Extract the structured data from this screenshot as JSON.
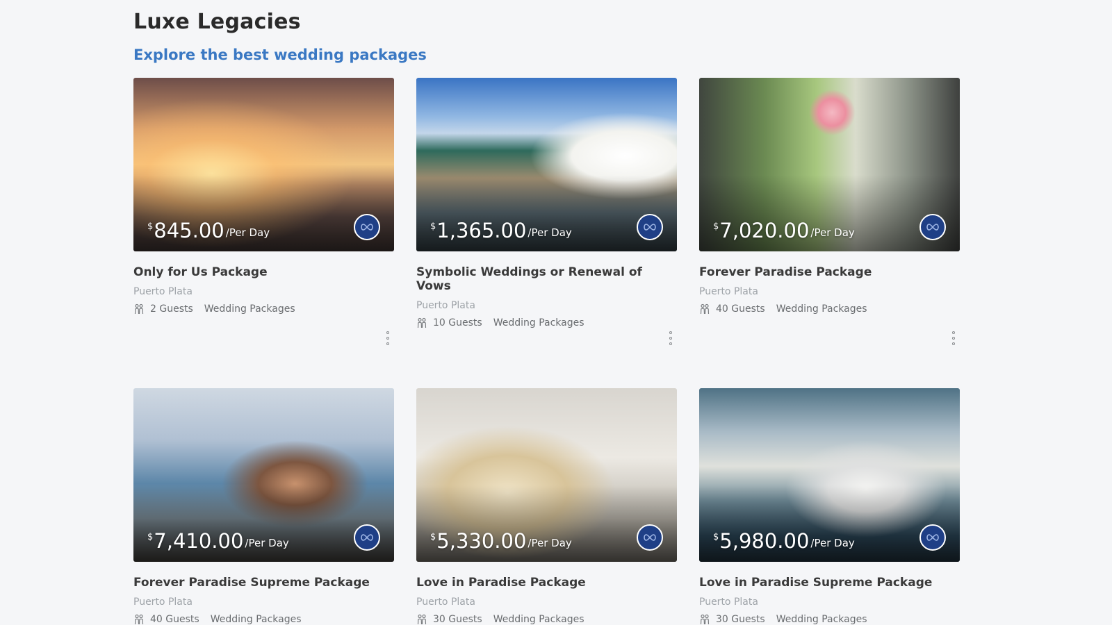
{
  "header": {
    "title": "Luxe Legacies",
    "subtitle": "Explore the best wedding packages"
  },
  "colors": {
    "accent": "#3a78c3",
    "badge": "#1f3f86",
    "background": "#f5f6f8"
  },
  "packages": [
    {
      "currency": "$",
      "price": "845.00",
      "unit": "/Per Day",
      "title": "Only for Us Package",
      "location": "Puerto Plata",
      "guests": "2 Guests",
      "category": "Wedding Packages",
      "image": "beach-sunset-couple"
    },
    {
      "currency": "$",
      "price": "1,365.00",
      "unit": "/Per Day",
      "title": "Symbolic Weddings or Renewal of Vows",
      "location": "Puerto Plata",
      "guests": "10 Guests",
      "category": "Wedding Packages",
      "image": "wedding-cake-palms"
    },
    {
      "currency": "$",
      "price": "7,020.00",
      "unit": "/Per Day",
      "title": "Forever Paradise Package",
      "location": "Puerto Plata",
      "guests": "40 Guests",
      "category": "Wedding Packages",
      "image": "reception-table-flowers"
    },
    {
      "currency": "$",
      "price": "7,410.00",
      "unit": "/Per Day",
      "title": "Forever Paradise Supreme Package",
      "location": "Puerto Plata",
      "guests": "40 Guests",
      "category": "Wedding Packages",
      "image": "bride-veil-sea"
    },
    {
      "currency": "$",
      "price": "5,330.00",
      "unit": "/Per Day",
      "title": "Love in Paradise Package",
      "location": "Puerto Plata",
      "guests": "30 Guests",
      "category": "Wedding Packages",
      "image": "menu-place-setting"
    },
    {
      "currency": "$",
      "price": "5,980.00",
      "unit": "/Per Day",
      "title": "Love in Paradise Supreme Package",
      "location": "Puerto Plata",
      "guests": "30 Guests",
      "category": "Wedding Packages",
      "image": "couple-beach-clouds"
    }
  ],
  "icons": {
    "badge": "infinity-icon",
    "guests": "guests-icon",
    "more": "more-vertical-icon"
  }
}
